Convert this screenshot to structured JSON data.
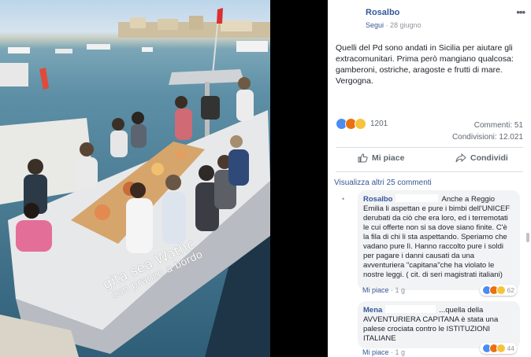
{
  "photo": {
    "boat_text_line1": "gita sea Wathc",
    "boat_text_line2": "con pranzo a bordo"
  },
  "post": {
    "author": "Rosalbo",
    "follow_label": "Segui",
    "separator": " · ",
    "date": "28 giugno",
    "more_icon": "•••",
    "text": "Quelli del Pd sono andati in Sicilia per aiutare gli extracomunitari. Prima però mangiano qualcosa: gamberoni, ostriche, aragoste e frutti di mare. Vergogna.",
    "reaction_icons": [
      "like-icon",
      "angry-icon",
      "haha-icon"
    ],
    "reaction_count": "1201",
    "comments_label": "Commenti: 51",
    "shares_label": "Condivisioni: 12.021",
    "like_label": "Mi piace",
    "share_label": "Condividi",
    "view_more": "Visualizza altri 25 commenti"
  },
  "comments": [
    {
      "author": "Rosalbo",
      "text": "Anche a Reggio Emilia li aspettan e pure i bimbi dell'UNICEF derubati da ciò che era loro, ed i terremotati le cui offerte non si sa dove siano finite. C'è la fila di chi li sta aspettando. Speriamo che vadano pure lì. Hanno raccolto pure i soldi per pagare i danni causati da una avventuriera \"capitana\"che ha violato le nostre leggi. ( cit. di seri magistrati italiani)",
      "reaction_count": "62",
      "like_label": "Mi piace",
      "time": "1 g"
    },
    {
      "author": "Mena",
      "text": "...quella della AVVENTURIERA CAPITANA è stata una palese crociata contro le ISTITUZIONI ITALIANE",
      "reaction_count": "44",
      "like_label": "Mi piace",
      "time": "1 g"
    }
  ],
  "colors": {
    "link": "#365899",
    "like": "#4b8cf1",
    "angry": "#e9710f",
    "haha": "#f7c33a"
  }
}
